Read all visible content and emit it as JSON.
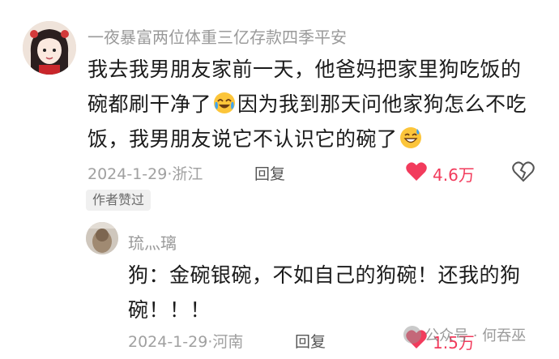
{
  "comment": {
    "username": "一夜暴富两位体重三亿存款四季平安",
    "text_part1": "我去我男朋友家前一天，他爸妈把家里狗吃饭的碗都刷干净了",
    "text_part2": "因为我到那天问他家狗怎么不吃饭，我男朋友说它不认识它的碗了",
    "emoji1": "crying-laughing-emoji",
    "emoji2": "grinning-sweat-emoji",
    "date_location": "2024-1-29·浙江",
    "reply_label": "回复",
    "like_count": "4.6万",
    "author_badge": "作者赞过"
  },
  "reply": {
    "username": "琉灬璃",
    "text": "狗：金碗银碗，不如自己的狗碗！还我的狗碗！！！",
    "date_location": "2024-1-29·河南",
    "reply_label": "回复",
    "like_count": "1.5万"
  },
  "watermark": {
    "text": "公众号 · 何吞巫"
  },
  "colors": {
    "like_red": "#f23b5c",
    "meta_gray": "#a0a0a0",
    "text_dark": "#1b1b1b"
  }
}
